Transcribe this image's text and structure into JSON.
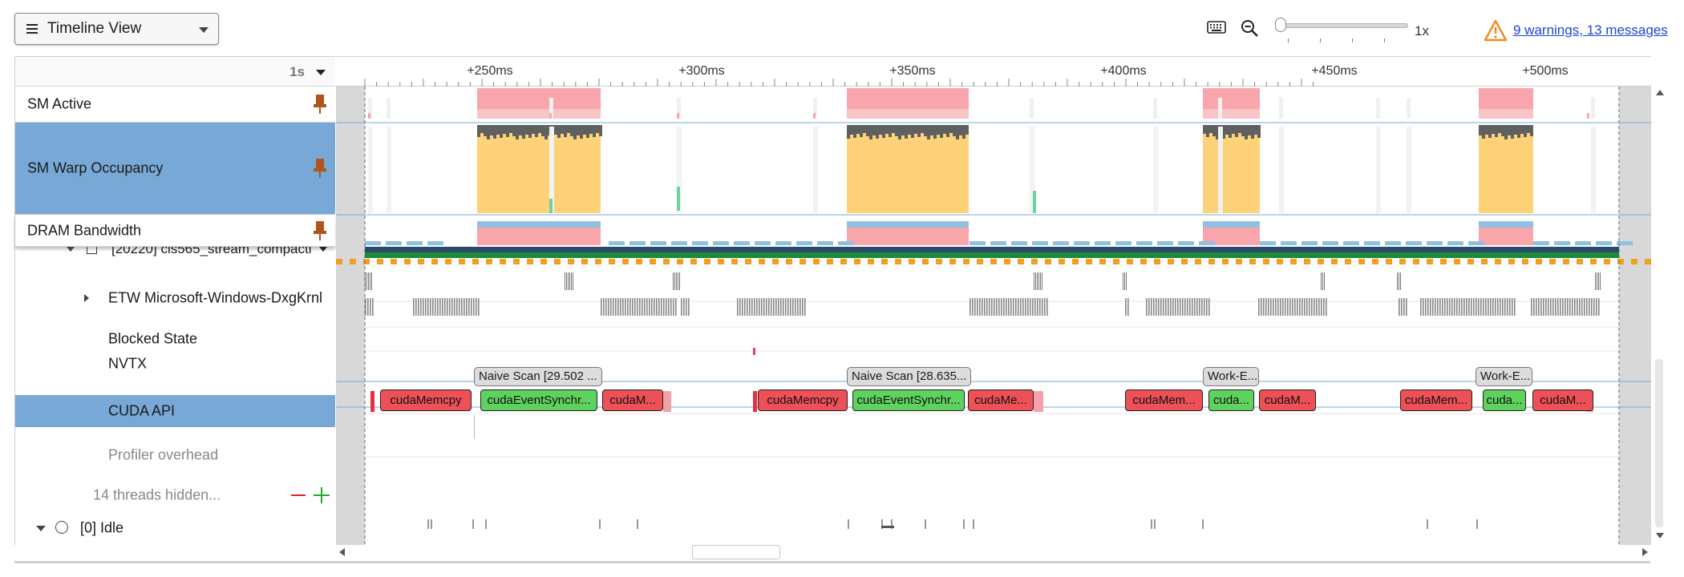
{
  "toolbar": {
    "view_select": "Timeline View",
    "zoom_level": "1x",
    "warnings_link": "9 warnings, 13 messages"
  },
  "left_panel": {
    "scale": "1s",
    "rows": {
      "sm_active": "SM Active",
      "sm_warp": "SM Warp Occupancy",
      "dram": "DRAM Bandwidth",
      "stream": "[20220] cis565_stream_compacti",
      "etw": "ETW Microsoft-Windows-DxgKrnl",
      "blocked": "Blocked State",
      "nvtx": "NVTX",
      "cuda_api": "CUDA API",
      "profiler": "Profiler overhead",
      "hidden": "14 threads hidden...",
      "idle": "[0] Idle"
    }
  },
  "ruler": {
    "ticks": [
      "+250ms",
      "+300ms",
      "+350ms",
      "+400ms",
      "+450ms",
      "+500ms"
    ]
  },
  "nvtx": [
    "Naive Scan [29.502 ...",
    "Naive Scan [28.635...",
    "Work-E...",
    "Work-E..."
  ],
  "cuda_api": [
    {
      "label": "cudaMemcpy",
      "kind": "red"
    },
    {
      "label": "cudaEventSynchr...",
      "kind": "green"
    },
    {
      "label": "cudaM...",
      "kind": "red"
    },
    {
      "label": "cudaMemcpy",
      "kind": "red"
    },
    {
      "label": "cudaEventSynchr...",
      "kind": "green"
    },
    {
      "label": "cudaMe...",
      "kind": "red"
    },
    {
      "label": "cudaMem...",
      "kind": "red"
    },
    {
      "label": "cuda...",
      "kind": "green"
    },
    {
      "label": "cudaM...",
      "kind": "red"
    },
    {
      "label": "cudaMem...",
      "kind": "red"
    },
    {
      "label": "cuda...",
      "kind": "green"
    },
    {
      "label": "cudaM...",
      "kind": "red"
    }
  ],
  "colors": {
    "selected_row": "#78a9d6",
    "sm_active": "#f9a5ac",
    "warp_fill": "#fdd279",
    "warp_top": "#606060",
    "dram_blue": "#8fc0de",
    "dram_pink": "#f9a5ac",
    "api_red": "#ee5057",
    "api_green": "#5fd15f",
    "stream_green": "#1e8a3c",
    "stream_orange": "#f0a020",
    "pin": "#b0541c",
    "warning": "#f08a20"
  }
}
